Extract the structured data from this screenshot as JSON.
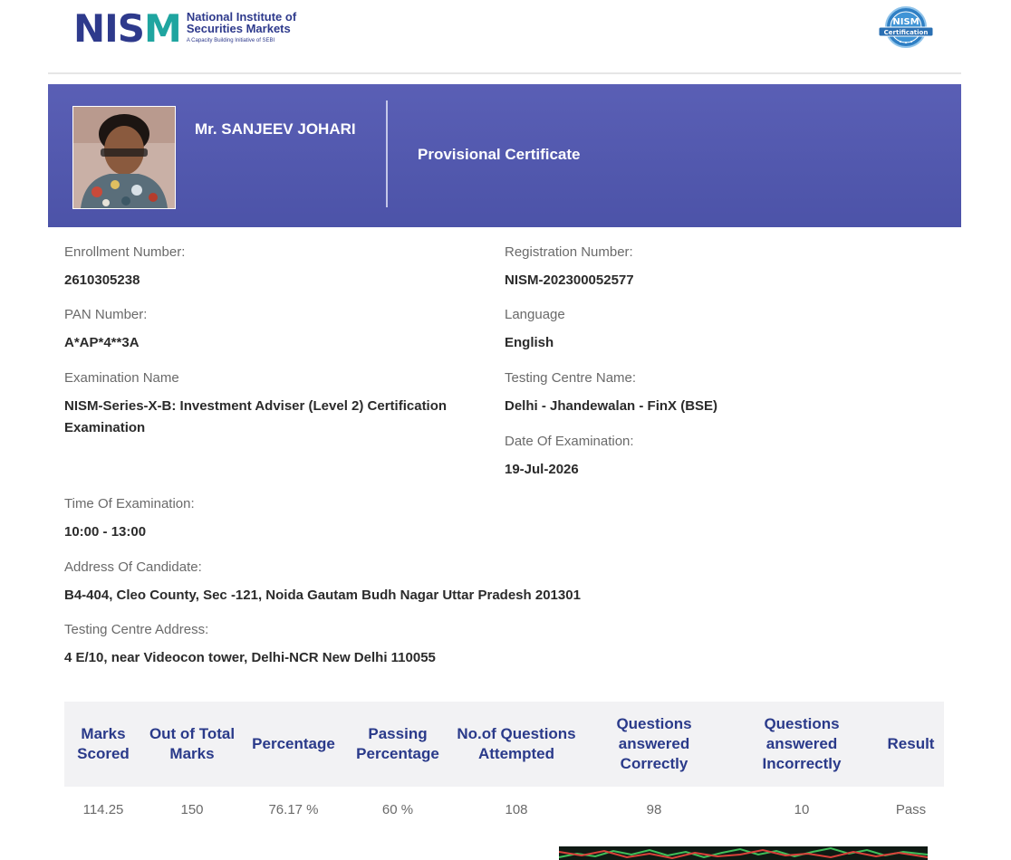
{
  "header": {
    "logo_mark": "NISM",
    "logo_line1": "National Institute of",
    "logo_line2": "Securities Markets",
    "logo_line3": "A Capacity Building Initiative of SEBI",
    "badge_top": "NISM",
    "badge_bottom": "Certification"
  },
  "banner": {
    "name": "Mr. SANJEEV JOHARI",
    "title": "Provisional Certificate"
  },
  "fields": {
    "enrollment_label": "Enrollment Number:",
    "enrollment_value": "2610305238",
    "registration_label": "Registration Number:",
    "registration_value": "NISM-202300052577",
    "pan_label": "PAN Number:",
    "pan_value": "A*AP*4**3A",
    "language_label": "Language",
    "language_value": "English",
    "exam_name_label": "Examination Name",
    "exam_name_value": "NISM-Series-X-B: Investment Adviser (Level 2) Certification Examination",
    "centre_name_label": "Testing Centre Name:",
    "centre_name_value": "Delhi - Jhandewalan - FinX (BSE)",
    "exam_date_label": "Date Of Examination:",
    "exam_date_value": "19-Jul-2026",
    "exam_time_label": "Time Of Examination:",
    "exam_time_value": "10:00 - 13:00",
    "address_label": "Address Of Candidate:",
    "address_value": "B4-404, Cleo County, Sec -121, Noida Gautam Budh Nagar Uttar Pradesh 201301",
    "centre_address_label": "Testing Centre Address:",
    "centre_address_value": "4 E/10, near Videocon tower, Delhi-NCR New Delhi 110055"
  },
  "results": {
    "headers": [
      "Marks Scored",
      "Out of Total Marks",
      "Percentage",
      "Passing Percentage",
      "No.of Questions Attempted",
      "Questions answered Correctly",
      "Questions answered Incorrectly",
      "Result"
    ],
    "values": [
      "114.25",
      "150",
      "76.17 %",
      "60 %",
      "108",
      "98",
      "10",
      "Pass"
    ]
  },
  "colors": {
    "banner": "#5157ad",
    "header_text": "#2a3a8a",
    "brand_teal": "#1fa5a0"
  }
}
